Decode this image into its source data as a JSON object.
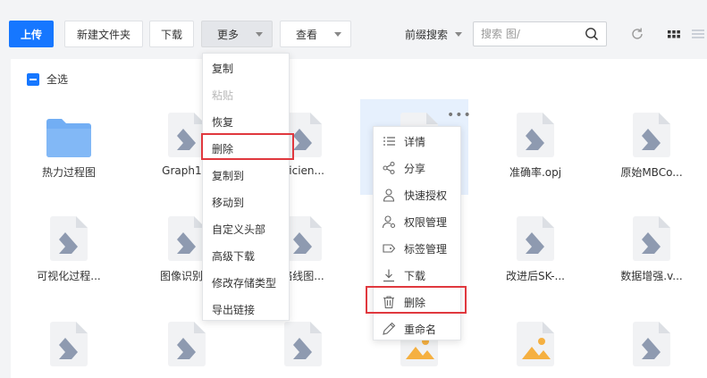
{
  "toolbar": {
    "upload": "上传",
    "new_folder": "新建文件夹",
    "download": "下载",
    "more": "更多",
    "view": "查看",
    "search_scope": "前缀搜索",
    "search_placeholder": "搜索 图/"
  },
  "select_all": "全选",
  "files": [
    {
      "name": "热力过程图",
      "type": "folder"
    },
    {
      "name": "Graph1.e",
      "type": "doc"
    },
    {
      "name": "fficien...",
      "type": "doc"
    },
    {
      "name": "",
      "type": "doc"
    },
    {
      "name": "准确率.opj",
      "type": "doc"
    },
    {
      "name": "原始MBCo...",
      "type": "doc"
    },
    {
      "name": "可视化过程...",
      "type": "doc"
    },
    {
      "name": "图像识别技",
      "type": "doc"
    },
    {
      "name": "络线图...",
      "type": "doc"
    },
    {
      "name": "",
      "type": "doc"
    },
    {
      "name": "改进后SK-...",
      "type": "doc"
    },
    {
      "name": "数据增强.v...",
      "type": "doc"
    },
    {
      "name": "",
      "type": "doc"
    },
    {
      "name": "",
      "type": "doc"
    },
    {
      "name": "",
      "type": "doc"
    },
    {
      "name": "",
      "type": "image"
    },
    {
      "name": "",
      "type": "image"
    },
    {
      "name": "",
      "type": "doc"
    }
  ],
  "more_menu": [
    {
      "label": "复制",
      "disabled": false
    },
    {
      "label": "粘贴",
      "disabled": true
    },
    {
      "label": "恢复",
      "disabled": false
    },
    {
      "label": "删除",
      "disabled": false
    },
    {
      "label": "复制到",
      "disabled": false
    },
    {
      "label": "移动到",
      "disabled": false
    },
    {
      "label": "自定义头部",
      "disabled": false
    },
    {
      "label": "高级下载",
      "disabled": false
    },
    {
      "label": "修改存储类型",
      "disabled": false
    },
    {
      "label": "导出链接",
      "disabled": false
    }
  ],
  "context_menu": [
    {
      "label": "详情",
      "icon": "list-icon"
    },
    {
      "label": "分享",
      "icon": "share-icon"
    },
    {
      "label": "快速授权",
      "icon": "user-icon"
    },
    {
      "label": "权限管理",
      "icon": "user-settings-icon"
    },
    {
      "label": "标签管理",
      "icon": "tag-icon"
    },
    {
      "label": "下载",
      "icon": "download-icon"
    },
    {
      "label": "删除",
      "icon": "trash-icon"
    },
    {
      "label": "重命名",
      "icon": "pencil-icon"
    }
  ],
  "colors": {
    "primary": "#1677ff",
    "highlight": "#e6f0fd",
    "annotation_red": "#e0383e",
    "doc_icon": "#8e9ab0",
    "folder": "#72aef4",
    "image_icon": "#f5b041"
  }
}
